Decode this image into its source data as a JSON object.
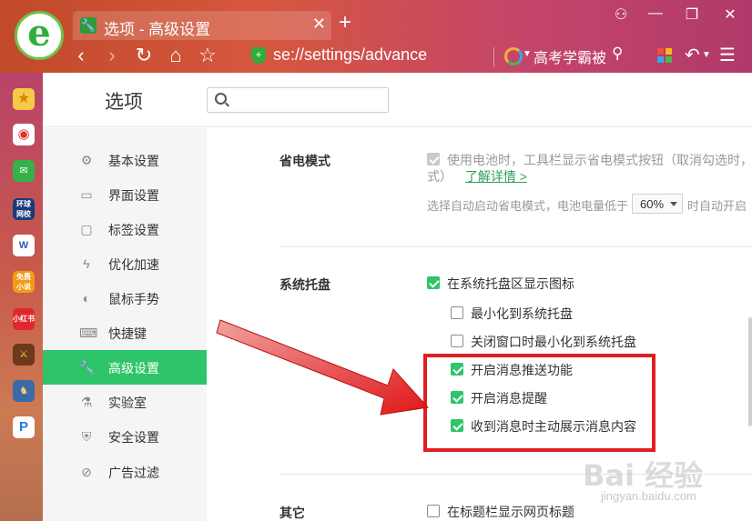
{
  "browser": {
    "tab_title": "选项 - 高级设置",
    "tab_close": "✕",
    "new_tab": "+",
    "address": "se://settings/advance",
    "hot_search": "高考学霸被",
    "colors": {
      "accent": "#2ec46a",
      "highlight": "#e02020"
    }
  },
  "window_controls": [
    "⚇",
    "—",
    "❐",
    "✕"
  ],
  "nav_buttons": [
    "‹",
    "›",
    "↻",
    "⌂",
    "☆"
  ],
  "page": {
    "title": "选项",
    "search_placeholder": ""
  },
  "nav": {
    "items": [
      {
        "label": "基本设置",
        "icon": "gear-icon"
      },
      {
        "label": "界面设置",
        "icon": "window-icon"
      },
      {
        "label": "标签设置",
        "icon": "tab-icon"
      },
      {
        "label": "优化加速",
        "icon": "lightning-icon"
      },
      {
        "label": "鼠标手势",
        "icon": "mouse-icon"
      },
      {
        "label": "快捷键",
        "icon": "keyboard-icon"
      },
      {
        "label": "高级设置",
        "icon": "wrench-icon",
        "active": true
      },
      {
        "label": "实验室",
        "icon": "flask-icon"
      },
      {
        "label": "安全设置",
        "icon": "shield-icon"
      },
      {
        "label": "广告过滤",
        "icon": "block-icon"
      }
    ]
  },
  "power_saving": {
    "title": "省电模式",
    "option_line1": "使用电池时，工具栏显示省电模式按钮（取消勾选时，将",
    "option_line2": "式）",
    "learn_more": "了解详情 >",
    "auto_prefix": "选择自动启动省电模式，电池电量低于",
    "battery_value": "60%",
    "auto_suffix": "时自动开启"
  },
  "tray": {
    "title": "系统托盘",
    "options": [
      {
        "label": "在系统托盘区显示图标",
        "checked": true
      },
      {
        "label": "最小化到系统托盘",
        "checked": false
      },
      {
        "label": "关闭窗口时最小化到系统托盘",
        "checked": false
      },
      {
        "label": "开启消息推送功能",
        "checked": true
      },
      {
        "label": "开启消息提醒",
        "checked": true
      },
      {
        "label": "收到消息时主动展示消息内容",
        "checked": true
      }
    ]
  },
  "other": {
    "title": "其它",
    "option": "在标题栏显示网页标题"
  },
  "watermark": {
    "main": "Bai  经验",
    "sub": "jingyan.baidu.com"
  }
}
